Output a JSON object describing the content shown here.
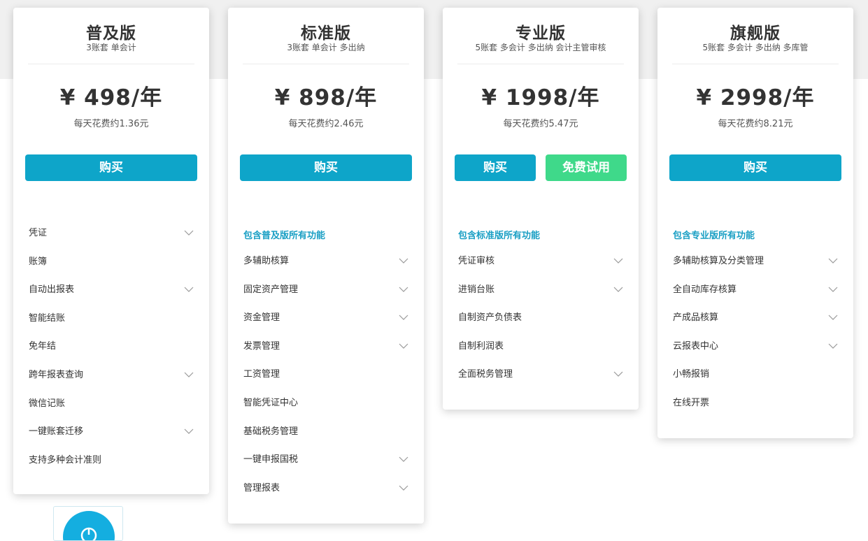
{
  "plans": [
    {
      "name": "普及版",
      "subtitle": "3账套 单会计",
      "price": "¥ 498/年",
      "daily": "每天花费约1.36元",
      "buttons": [
        {
          "label": "购买",
          "kind": "buy"
        }
      ],
      "includes": "",
      "features": [
        {
          "label": "凭证",
          "expandable": true
        },
        {
          "label": "账簿",
          "expandable": false
        },
        {
          "label": "自动出报表",
          "expandable": true
        },
        {
          "label": "智能结账",
          "expandable": false
        },
        {
          "label": "免年结",
          "expandable": false
        },
        {
          "label": "跨年报表查询",
          "expandable": true
        },
        {
          "label": "微信记账",
          "expandable": false
        },
        {
          "label": "一键账套迁移",
          "expandable": true
        },
        {
          "label": "支持多种会计准则",
          "expandable": false
        }
      ]
    },
    {
      "name": "标准版",
      "subtitle": "3账套 单会计 多出纳",
      "price": "¥ 898/年",
      "daily": "每天花费约2.46元",
      "buttons": [
        {
          "label": "购买",
          "kind": "buy"
        }
      ],
      "includes": "包含普及版所有功能",
      "features": [
        {
          "label": "多辅助核算",
          "expandable": true
        },
        {
          "label": "固定资产管理",
          "expandable": true
        },
        {
          "label": "资金管理",
          "expandable": true
        },
        {
          "label": "发票管理",
          "expandable": true
        },
        {
          "label": "工资管理",
          "expandable": false
        },
        {
          "label": "智能凭证中心",
          "expandable": false
        },
        {
          "label": "基础税务管理",
          "expandable": false
        },
        {
          "label": "一键申报国税",
          "expandable": true
        },
        {
          "label": "管理报表",
          "expandable": true
        }
      ]
    },
    {
      "name": "专业版",
      "subtitle": "5账套 多会计 多出纳 会计主管审核",
      "price": "¥ 1998/年",
      "daily": "每天花费约5.47元",
      "buttons": [
        {
          "label": "购买",
          "kind": "buy"
        },
        {
          "label": "免费试用",
          "kind": "trial"
        }
      ],
      "includes": "包含标准版所有功能",
      "features": [
        {
          "label": "凭证审核",
          "expandable": true
        },
        {
          "label": "进销台账",
          "expandable": true
        },
        {
          "label": "自制资产负债表",
          "expandable": false
        },
        {
          "label": "自制利润表",
          "expandable": false
        },
        {
          "label": "全面税务管理",
          "expandable": true
        }
      ]
    },
    {
      "name": "旗舰版",
      "subtitle": "5账套 多会计 多出纳 多库管",
      "price": "¥ 2998/年",
      "daily": "每天花费约8.21元",
      "buttons": [
        {
          "label": "购买",
          "kind": "buy"
        }
      ],
      "includes": "包含专业版所有功能",
      "features": [
        {
          "label": "多辅助核算及分类管理",
          "expandable": true
        },
        {
          "label": "全自动库存核算",
          "expandable": true
        },
        {
          "label": "产成品核算",
          "expandable": true
        },
        {
          "label": "云报表中心",
          "expandable": true
        },
        {
          "label": "小畅报销",
          "expandable": false
        },
        {
          "label": "在线开票",
          "expandable": false
        }
      ]
    }
  ],
  "colors": {
    "buy": "#0ea5c9",
    "trial": "#3fd98a",
    "includes": "#1a9fc4",
    "background_band": "#f0f0f0"
  },
  "icons": {
    "expand": "chevron-down-icon",
    "float_widget": "customer-service-icon"
  }
}
